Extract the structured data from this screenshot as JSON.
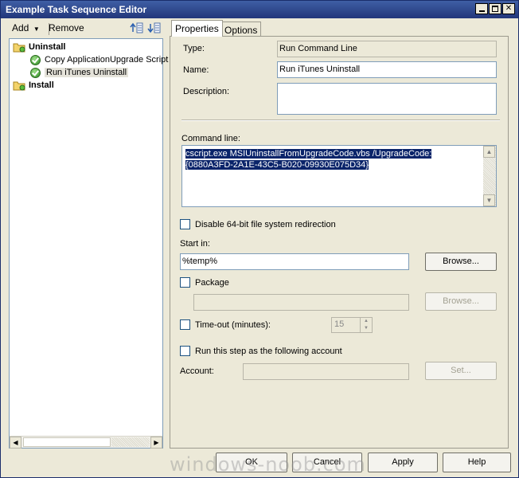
{
  "window": {
    "title": "Example Task Sequence Editor"
  },
  "toolbar": {
    "add_label": "Add",
    "remove_label": "Remove"
  },
  "tree": {
    "items": [
      {
        "label": "Uninstall",
        "type": "group"
      },
      {
        "label": "Copy ApplicationUpgrade Script",
        "type": "step"
      },
      {
        "label": "Run iTunes Uninstall",
        "type": "step",
        "selected": true
      },
      {
        "label": "Install",
        "type": "group"
      }
    ]
  },
  "tabs": [
    {
      "label": "Properties",
      "active": true
    },
    {
      "label": "Options",
      "active": false
    }
  ],
  "properties": {
    "type_label": "Type:",
    "type_value": "Run Command Line",
    "name_label": "Name:",
    "name_value": "Run iTunes Uninstall",
    "description_label": "Description:",
    "description_value": "",
    "command_label": "Command line:",
    "command_value": "cscript.exe MSIUninstallFromUpgradeCode.vbs /UpgradeCode:{0880A3FD-2A1E-43C5-B020-09930E075D34}",
    "disable_redirection_label": "Disable 64-bit file system redirection",
    "start_in_label": "Start in:",
    "start_in_value": "%temp%",
    "browse_label": "Browse...",
    "package_label": "Package",
    "package_value": "",
    "package_browse_label": "Browse...",
    "timeout_label": "Time-out (minutes):",
    "timeout_value": "15",
    "run_as_label": "Run this step as the following account",
    "account_label": "Account:",
    "account_value": "",
    "set_label": "Set..."
  },
  "footer": {
    "ok_label": "OK",
    "cancel_label": "Cancel",
    "apply_label": "Apply",
    "help_label": "Help"
  },
  "watermark": "windows-noob.com",
  "colors": {
    "title_bar": "#22367a",
    "selection": "#0a246a",
    "dialog_bg": "#ece9d8"
  }
}
